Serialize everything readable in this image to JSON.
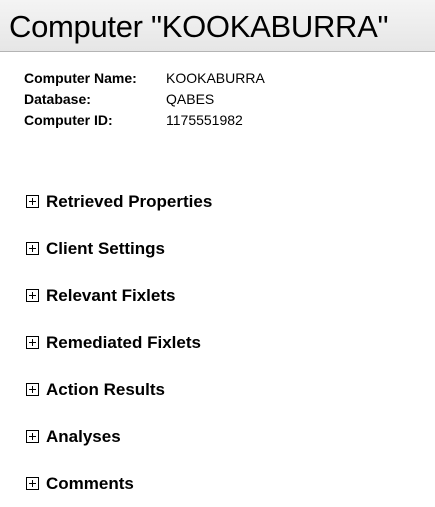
{
  "header": {
    "title": "Computer \"KOOKABURRA\""
  },
  "info": {
    "rows": [
      {
        "label": "Computer Name:",
        "value": "KOOKABURRA"
      },
      {
        "label": "Database:",
        "value": "QABES"
      },
      {
        "label": "Computer ID:",
        "value": "1175551982"
      }
    ]
  },
  "sections": [
    {
      "label": "Retrieved Properties",
      "icon": "expand-plus-icon"
    },
    {
      "label": "Client Settings",
      "icon": "expand-plus-icon"
    },
    {
      "label": "Relevant Fixlets",
      "icon": "expand-plus-icon"
    },
    {
      "label": "Remediated Fixlets",
      "icon": "expand-plus-icon"
    },
    {
      "label": "Action Results",
      "icon": "expand-plus-icon"
    },
    {
      "label": "Analyses",
      "icon": "expand-plus-icon"
    },
    {
      "label": "Comments",
      "icon": "expand-plus-icon"
    }
  ]
}
